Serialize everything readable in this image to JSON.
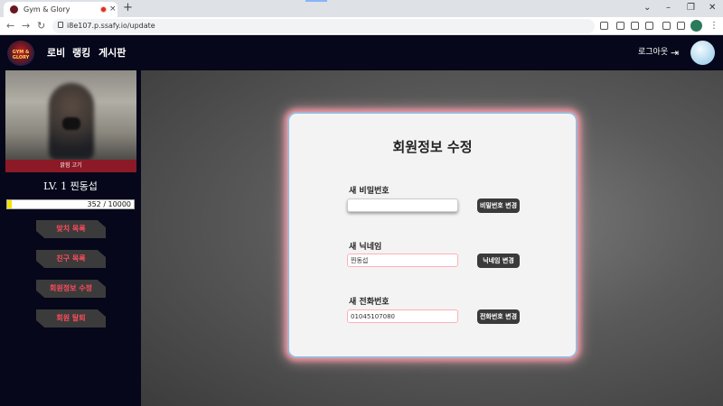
{
  "browser": {
    "tab_title": "Gym & Glory",
    "tab_close": "×",
    "new_tab": "+",
    "url": "i8e107.p.ssafy.io/update",
    "window_controls": [
      "⌄",
      "–",
      "❐",
      "✕"
    ],
    "nav": [
      "←",
      "→",
      "↻"
    ]
  },
  "header": {
    "logo_text": "GYM & GLORY",
    "menu": [
      "로비",
      "랭킹",
      "게시판"
    ],
    "logout_label": "로그아웃",
    "logout_icon": "⇥"
  },
  "sidebar": {
    "cam_label": "밝힘 고기",
    "level_text": "LV. 1 찐동섭",
    "xp_text": "352 / 10000",
    "xp_fraction": 0.0352,
    "buttons": [
      "맞치 목록",
      "친구 목록",
      "회원정보 수정",
      "회원 탈퇴"
    ]
  },
  "card": {
    "title": "회원정보 수정",
    "password_label": "새 비밀번호",
    "password_value": "",
    "password_button": "비밀번호 변경",
    "nickname_label": "새 닉네임",
    "nickname_value": "찐동섭",
    "nickname_button": "닉네임 변경",
    "phone_label": "새 전화번호",
    "phone_value": "01045107080",
    "phone_button": "전화번호 변경"
  },
  "colors": {
    "header_bg": "#06071a",
    "accent_red": "#8b1a26",
    "button_text_red": "#ff4b5c",
    "xp_fill": "#f7e100",
    "card_border": "#9ab9d8"
  }
}
